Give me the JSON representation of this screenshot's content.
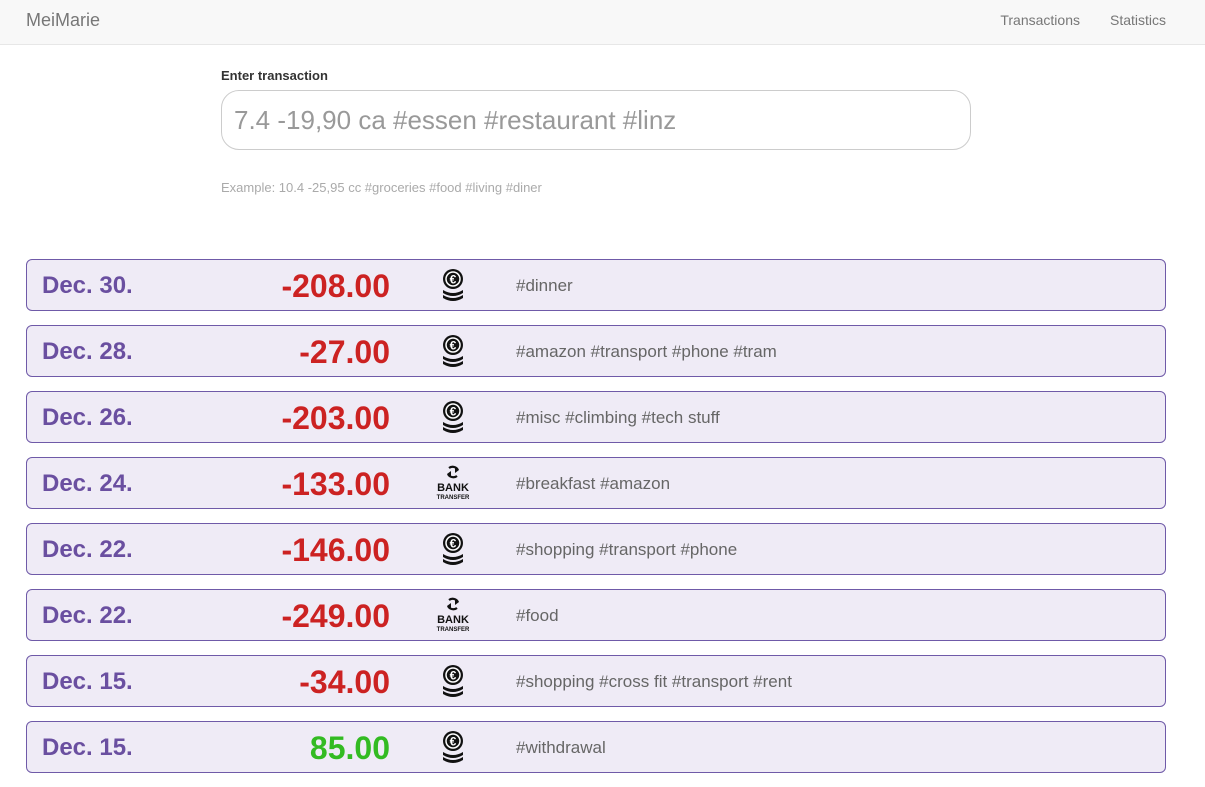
{
  "app": {
    "brand": "MeiMarie",
    "nav": [
      {
        "label": "Transactions"
      },
      {
        "label": "Statistics"
      }
    ]
  },
  "entry": {
    "label": "Enter transaction",
    "placeholder": "7.4 -19,90 ca #essen #restaurant #linz",
    "help": "Example: 10.4 -25,95 cc #groceries #food #living #diner"
  },
  "colors": {
    "accent": "#6a4fa0",
    "negative": "#cc2222",
    "positive": "#33bb22",
    "row_bg": "#efebf6"
  },
  "transactions": [
    {
      "date": "Dec. 30.",
      "amount": "-208.00",
      "type": "cash",
      "icon": "euro-coins-icon",
      "tags": "#dinner"
    },
    {
      "date": "Dec. 28.",
      "amount": "-27.00",
      "type": "cash",
      "icon": "euro-coins-icon",
      "tags": "#amazon #transport #phone #tram"
    },
    {
      "date": "Dec. 26.",
      "amount": "-203.00",
      "type": "cash",
      "icon": "euro-coins-icon",
      "tags": "#misc #climbing #tech stuff"
    },
    {
      "date": "Dec. 24.",
      "amount": "-133.00",
      "type": "bank",
      "icon": "bank-transfer-icon",
      "tags": "#breakfast #amazon"
    },
    {
      "date": "Dec. 22.",
      "amount": "-146.00",
      "type": "cash",
      "icon": "euro-coins-icon",
      "tags": "#shopping #transport #phone"
    },
    {
      "date": "Dec. 22.",
      "amount": "-249.00",
      "type": "bank",
      "icon": "bank-transfer-icon",
      "tags": "#food"
    },
    {
      "date": "Dec. 15.",
      "amount": "-34.00",
      "type": "cash",
      "icon": "euro-coins-icon",
      "tags": "#shopping #cross fit #transport #rent"
    },
    {
      "date": "Dec. 15.",
      "amount": "85.00",
      "type": "cash",
      "icon": "euro-coins-icon",
      "tags": "#withdrawal"
    }
  ],
  "icon_text": {
    "bank_top": "BANK",
    "bank_bottom": "TRANSFER"
  }
}
